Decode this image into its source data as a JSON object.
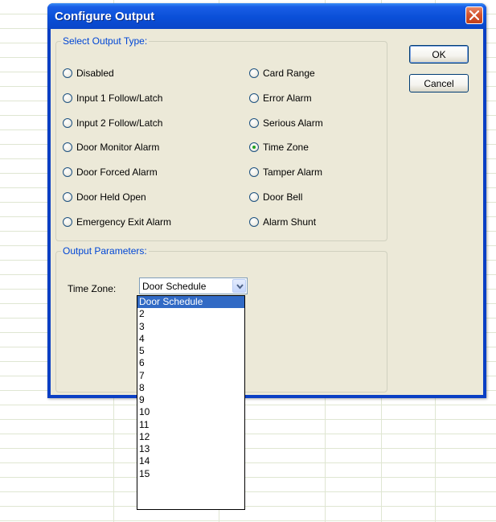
{
  "dialog": {
    "title": "Configure Output",
    "ok_label": "OK",
    "cancel_label": "Cancel"
  },
  "output_type": {
    "legend": "Select Output Type:",
    "left_options": [
      "Disabled",
      "Input 1 Follow/Latch",
      "Input 2 Follow/Latch",
      "Door Monitor Alarm",
      "Door Forced Alarm",
      "Door Held Open",
      "Emergency Exit Alarm"
    ],
    "right_options": [
      "Card Range",
      "Error Alarm",
      "Serious Alarm",
      "Time Zone",
      "Tamper Alarm",
      "Door Bell",
      "Alarm Shunt"
    ],
    "selected": "Time Zone"
  },
  "output_parameters": {
    "legend": "Output Parameters:",
    "time_zone_label": "Time Zone:",
    "time_zone_value": "Door Schedule",
    "time_zone_options": [
      "Door Schedule",
      "2",
      "3",
      "4",
      "5",
      "6",
      "7",
      "8",
      "9",
      "10",
      "11",
      "12",
      "13",
      "14",
      "15"
    ]
  },
  "colors": {
    "title_bar": "#0a4fd8",
    "legend_text": "#0046d5",
    "selection": "#316ac5",
    "radio_dot": "#21a121"
  },
  "icons": {
    "close": "close-icon",
    "dropdown": "chevron-down-icon"
  }
}
